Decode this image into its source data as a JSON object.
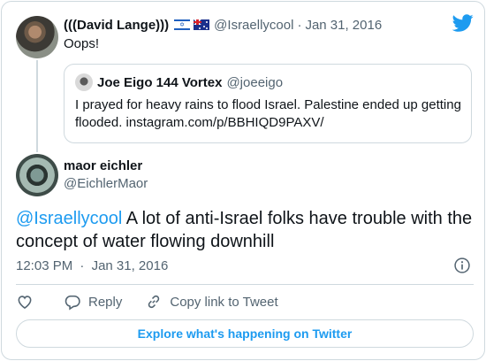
{
  "brand": {
    "accent": "#1d9bf0",
    "text": "#0f1419",
    "muted": "#536471",
    "border": "#cfd9de"
  },
  "parent_tweet": {
    "name": "(((David Lange)))",
    "flags": [
      "israel-flag-icon",
      "australia-flag-icon"
    ],
    "handle": "@Israellycool",
    "separator": "·",
    "date": "Jan 31, 2016",
    "text": "Oops!"
  },
  "quoted_tweet": {
    "name": "Joe Eigo 144 Vortex",
    "handle": "@joeeigo",
    "text": "I prayed for heavy rains to flood Israel.  Palestine ended up getting flooded. instagram.com/p/BBHIQD9PAXV/"
  },
  "main_tweet": {
    "name": "maor eichler",
    "handle": "@EichlerMaor",
    "mention": "@Israellycool",
    "text": " A lot of anti-Israel folks have trouble with the concept of water flowing downhill",
    "time": "12:03 PM",
    "separator": "·",
    "date": "Jan 31, 2016"
  },
  "actions": {
    "reply_label": "Reply",
    "copy_link_label": "Copy link to Tweet"
  },
  "explore_label": "Explore what's happening on Twitter",
  "icons": [
    "twitter-bird-icon",
    "info-icon",
    "heart-icon",
    "reply-icon",
    "link-icon"
  ]
}
